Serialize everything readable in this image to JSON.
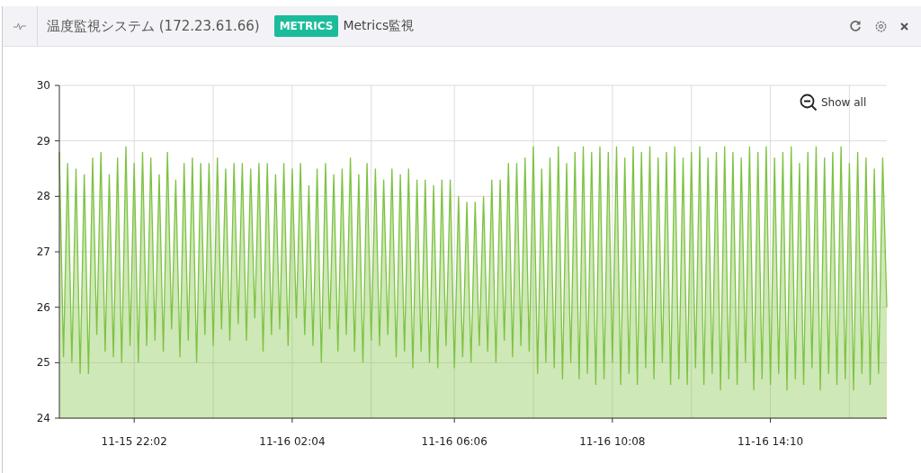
{
  "header": {
    "title": "温度監視システム (172.23.61.66)",
    "badge": "METRICS",
    "subtitle": "Metrics監視"
  },
  "chart": {
    "show_all": "Show all",
    "chart_data": {
      "type": "area",
      "grid": true,
      "ylim": [
        24,
        30
      ],
      "yticks": [
        24,
        25,
        26,
        27,
        28,
        29,
        30
      ],
      "categories": [
        null,
        null,
        null,
        null,
        null,
        null,
        null,
        null,
        null,
        null,
        null,
        null,
        null,
        null,
        null,
        null,
        null,
        null,
        "11-15 22:02",
        null,
        null,
        null,
        null,
        null,
        null,
        null,
        null,
        null,
        null,
        null,
        null,
        null,
        null,
        null,
        null,
        null,
        null,
        null,
        null,
        null,
        null,
        null,
        null,
        null,
        null,
        null,
        null,
        null,
        null,
        null,
        null,
        null,
        null,
        null,
        null,
        null,
        "11-16 02:04",
        null,
        null,
        null,
        null,
        null,
        null,
        null,
        null,
        null,
        null,
        null,
        null,
        null,
        null,
        null,
        null,
        null,
        null,
        null,
        null,
        null,
        null,
        null,
        null,
        null,
        null,
        null,
        null,
        null,
        null,
        null,
        null,
        null,
        null,
        null,
        null,
        null,
        null,
        "11-16 06:06",
        null,
        null,
        null,
        null,
        null,
        null,
        null,
        null,
        null,
        null,
        null,
        null,
        null,
        null,
        null,
        null,
        null,
        null,
        null,
        null,
        null,
        null,
        null,
        null,
        null,
        null,
        null,
        null,
        null,
        null,
        null,
        null,
        null,
        null,
        null,
        null,
        null,
        "11-16 10:08",
        null,
        null,
        null,
        null,
        null,
        null,
        null,
        null,
        null,
        null,
        null,
        null,
        null,
        null,
        null,
        null,
        null,
        null,
        null,
        null,
        null,
        null,
        null,
        null,
        null,
        null,
        null,
        null,
        null,
        null,
        null,
        null,
        null,
        null,
        null,
        null,
        null,
        "11-16 14:10",
        null,
        null,
        null,
        null,
        null,
        null,
        null,
        null,
        null,
        null,
        null,
        null,
        null,
        null,
        null,
        null,
        null,
        null,
        null,
        null,
        null,
        null,
        null,
        null,
        null,
        null,
        null,
        null
      ],
      "series": [
        {
          "color": "#7dc242",
          "values": [
            28.8,
            25.1,
            28.6,
            25.0,
            28.5,
            24.8,
            28.4,
            24.8,
            28.7,
            25.5,
            28.8,
            25.2,
            28.4,
            25.1,
            28.7,
            25.0,
            28.9,
            25.3,
            28.6,
            25.0,
            28.8,
            25.3,
            28.7,
            25.4,
            28.4,
            25.2,
            28.8,
            25.6,
            28.3,
            25.1,
            28.6,
            25.4,
            28.7,
            25.0,
            28.6,
            25.5,
            28.6,
            25.3,
            28.7,
            25.6,
            28.5,
            25.4,
            28.6,
            25.7,
            28.6,
            25.4,
            28.5,
            25.8,
            28.6,
            25.2,
            28.6,
            25.5,
            28.4,
            25.6,
            28.6,
            25.3,
            28.5,
            25.8,
            28.6,
            25.5,
            28.2,
            25.3,
            28.5,
            25.0,
            28.6,
            25.6,
            28.4,
            25.2,
            28.5,
            25.5,
            28.7,
            25.2,
            28.4,
            25.0,
            28.6,
            25.4,
            28.5,
            25.3,
            28.3,
            25.5,
            28.5,
            25.1,
            28.4,
            25.2,
            28.5,
            24.9,
            28.3,
            25.2,
            28.3,
            25.0,
            28.2,
            24.9,
            28.3,
            25.3,
            28.3,
            24.9,
            28.0,
            25.1,
            27.9,
            25.0,
            27.9,
            25.3,
            28.0,
            25.2,
            28.3,
            25.0,
            28.3,
            25.4,
            28.6,
            25.1,
            28.6,
            25.3,
            28.7,
            25.2,
            28.9,
            24.8,
            28.5,
            25.0,
            28.7,
            24.9,
            28.9,
            24.7,
            28.6,
            25.0,
            28.8,
            24.7,
            28.9,
            24.8,
            28.8,
            24.6,
            28.9,
            24.7,
            28.8,
            25.0,
            28.9,
            24.6,
            28.7,
            24.8,
            28.9,
            24.6,
            28.8,
            24.9,
            28.9,
            24.7,
            28.7,
            25.0,
            28.8,
            24.6,
            28.9,
            24.7,
            28.7,
            24.6,
            28.8,
            24.9,
            28.9,
            24.6,
            28.7,
            24.8,
            28.8,
            24.5,
            28.9,
            24.7,
            28.8,
            24.6,
            28.7,
            25.0,
            28.9,
            24.5,
            28.8,
            24.7,
            28.9,
            24.6,
            28.7,
            24.8,
            28.8,
            24.5,
            28.9,
            24.7,
            28.6,
            24.6,
            28.8,
            24.9,
            28.9,
            24.5,
            28.7,
            24.8,
            28.8,
            24.6,
            28.9,
            24.7,
            28.6,
            24.5,
            28.8,
            24.8,
            28.7,
            24.6,
            28.5,
            24.8,
            28.7,
            26.0
          ]
        }
      ]
    }
  }
}
